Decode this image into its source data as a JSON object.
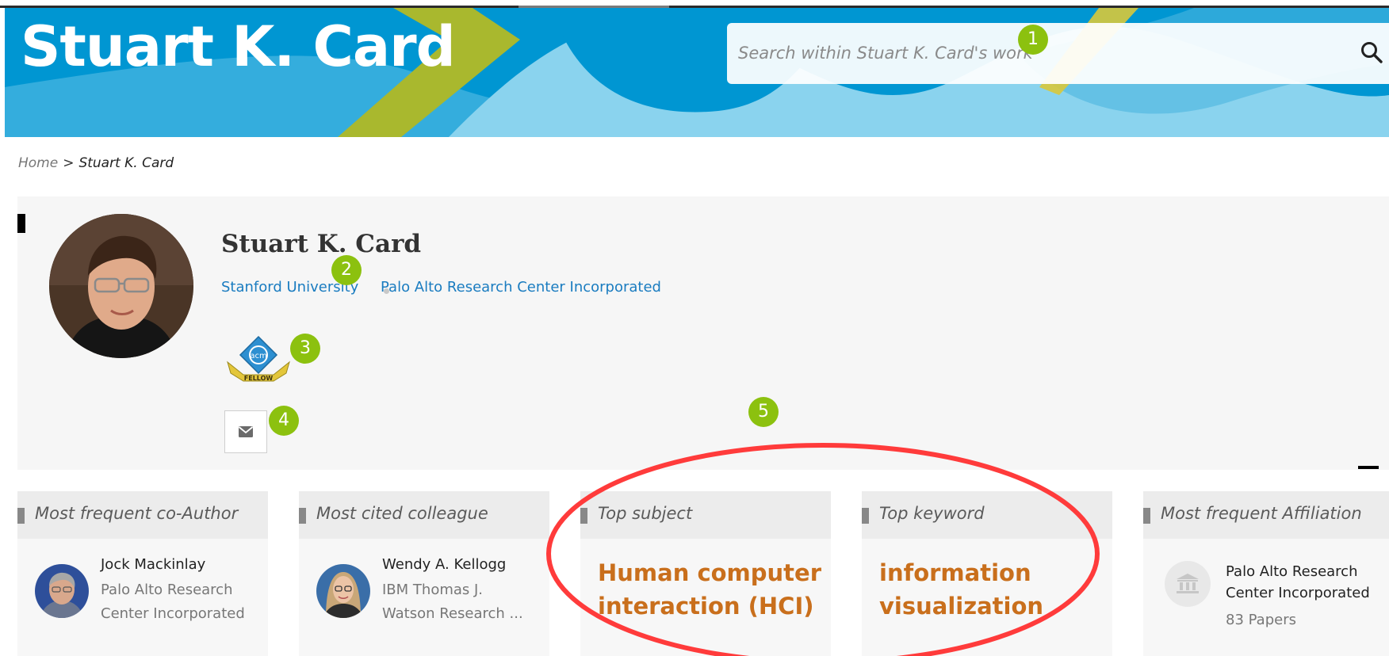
{
  "banner": {
    "title": "Stuart K. Card",
    "search_placeholder": "Search within Stuart K. Card's work",
    "colors": {
      "primary": "#0096d2",
      "light": "#8ad3ee",
      "chevron": "#a9b82e"
    }
  },
  "breadcrumb": {
    "home": "Home",
    "separator": ">",
    "current": "Stuart K. Card"
  },
  "profile": {
    "name": "Stuart K. Card",
    "affiliations": [
      "Stanford University",
      "Palo Alto Research Center Incorporated"
    ],
    "badge": {
      "icon": "acm-fellow-badge",
      "text": "acm",
      "ribbon": "FELLOW"
    },
    "mail_icon": "envelope-icon"
  },
  "markers": [
    "1",
    "2",
    "3",
    "4",
    "5"
  ],
  "cards": {
    "coauthor": {
      "label": "Most frequent co-Author",
      "name": "Jock Mackinlay",
      "affiliation_line1": "Palo Alto Research",
      "affiliation_line2": "Center Incorporated"
    },
    "cited": {
      "label": "Most cited colleague",
      "name": "Wendy A. Kellogg",
      "affiliation_line1": "IBM Thomas J.",
      "affiliation_line2": "Watson Research ..."
    },
    "subject": {
      "label": "Top subject",
      "term_line1": "Human computer",
      "term_line2": "interaction (HCI)"
    },
    "keyword": {
      "label": "Top keyword",
      "term_line1": "information",
      "term_line2": "visualization"
    },
    "affiliation": {
      "label": "Most frequent Affiliation",
      "name_line1": "Palo Alto Research",
      "name_line2": "Center Incorporated",
      "count": "83 Papers"
    }
  },
  "highlight_color": "#ff3b3b"
}
